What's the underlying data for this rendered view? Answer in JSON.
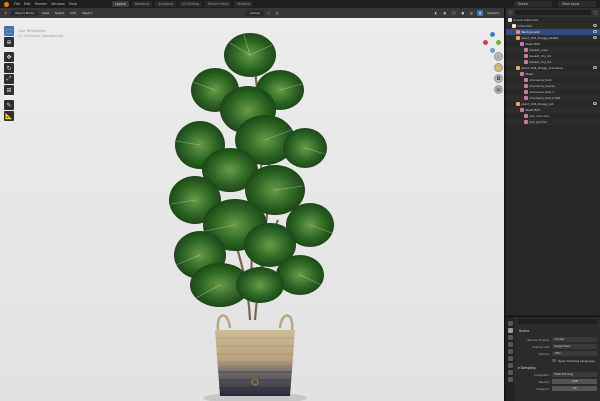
{
  "topbar": {
    "menus": [
      "File",
      "Edit",
      "Render",
      "Window",
      "Help"
    ],
    "tabs": [
      "Layout",
      "Modeling",
      "Sculpting",
      "UV Editing",
      "Texture Paint",
      "Shading"
    ],
    "active_tab": 0,
    "scene_field": "Scene",
    "view_layer_field": "View Layer"
  },
  "viewport": {
    "mode_select": "Object Mode",
    "menus": [
      "View",
      "Select",
      "Add",
      "Object"
    ],
    "transform_select": "Global",
    "options_label": "Options",
    "hud_lines": [
      "User Perspective",
      "(1) Collection | Background"
    ]
  },
  "outliner": {
    "title": "Scene Collection",
    "rows": [
      {
        "depth": 0,
        "label": "Scene Collection",
        "icon": "coll"
      },
      {
        "depth": 1,
        "label": "Collection",
        "icon": "coll"
      },
      {
        "depth": 2,
        "label": "Background",
        "icon": "obj",
        "selected": true
      },
      {
        "depth": 2,
        "label": "plant_004_Dragg_basket",
        "icon": "empty"
      },
      {
        "depth": 3,
        "label": "Mesh.803",
        "icon": "mesh"
      },
      {
        "depth": 4,
        "label": "basket_rope",
        "icon": "mesh"
      },
      {
        "depth": 4,
        "label": "basket_dry_01",
        "icon": "mesh"
      },
      {
        "depth": 4,
        "label": "basket_dry_02",
        "icon": "mesh"
      },
      {
        "depth": 2,
        "label": "plant_004_Dragg_dracaena",
        "icon": "empty"
      },
      {
        "depth": 3,
        "label": "Mesh",
        "icon": "mesh"
      },
      {
        "depth": 4,
        "label": "dracaena_bark",
        "icon": "mesh"
      },
      {
        "depth": 4,
        "label": "dracaena_leaves",
        "icon": "mesh"
      },
      {
        "depth": 4,
        "label": "dracaena_leaf_1",
        "icon": "mesh"
      },
      {
        "depth": 4,
        "label": "dracaena_leaf_2.001",
        "icon": "mesh"
      },
      {
        "depth": 2,
        "label": "plant_004_Dragg_pot",
        "icon": "empty"
      },
      {
        "depth": 3,
        "label": "Mesh.802",
        "icon": "mesh"
      },
      {
        "depth": 4,
        "label": "pot_coco.noc",
        "icon": "mesh"
      },
      {
        "depth": 4,
        "label": "pot_ground",
        "icon": "mesh"
      }
    ]
  },
  "properties": {
    "title": "Scene",
    "rows": [
      {
        "label": "Render Engine",
        "value": "Cycles"
      },
      {
        "label": "Feature Set",
        "value": "Supported"
      },
      {
        "label": "Device",
        "value": "CPU"
      }
    ],
    "checkbox_label": "Open Shading Language",
    "sampling_label": "Sampling",
    "integrator": {
      "label": "Integrator",
      "value": "Path Tracing"
    },
    "render_samples": {
      "label": "Render",
      "value": "128"
    },
    "viewport_samples": {
      "label": "Viewport",
      "value": "32"
    }
  },
  "colors": {
    "accent": "#4772b3",
    "selection": "#334d80",
    "axis_x": "#e0384c",
    "axis_y": "#6fb23a",
    "axis_z": "#3a7ee0"
  }
}
